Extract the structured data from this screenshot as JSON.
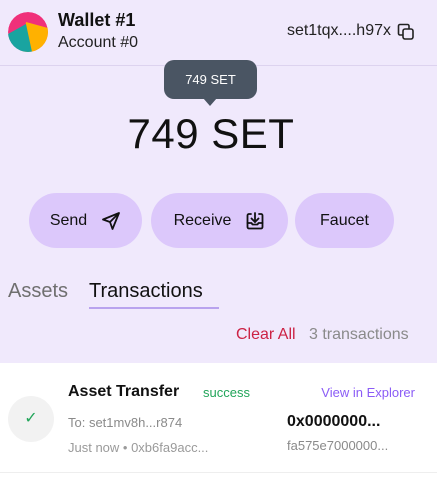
{
  "header": {
    "wallet_name": "Wallet #1",
    "account_name": "Account #0",
    "address": "set1tqx....h97x",
    "avatar_colors": [
      "#f0307a",
      "#ffb100",
      "#19a4a0"
    ]
  },
  "tooltip": {
    "text": "749 SET"
  },
  "balance": {
    "text": "749 SET"
  },
  "actions": {
    "send_label": "Send",
    "receive_label": "Receive",
    "faucet_label": "Faucet"
  },
  "tabs": {
    "assets_label": "Assets",
    "transactions_label": "Transactions",
    "active": "Transactions"
  },
  "transactions_toolbar": {
    "clear_all_label": "Clear All",
    "count_text": "3 transactions"
  },
  "transactions": [
    {
      "title": "Asset Transfer",
      "status": "success",
      "explorer_label": "View in Explorer",
      "to": "To: set1mv8h...r874",
      "meta": "Just now • 0xb6fa9acc...",
      "amount": "0x0000000...",
      "hash": "fa575e7000000..."
    }
  ],
  "colors": {
    "panel_bg": "#f0e9fc",
    "button_bg": "#dcc8fb",
    "accent": "#8b5cf6",
    "danger": "#cc2244",
    "success": "#22a55a"
  }
}
